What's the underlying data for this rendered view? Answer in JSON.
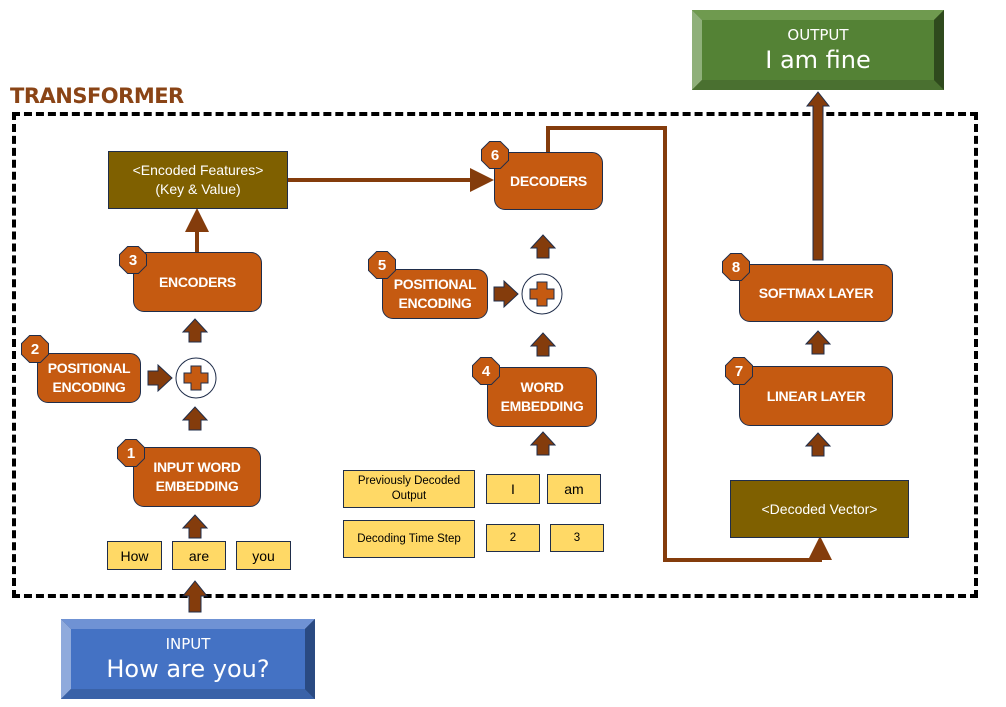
{
  "title": "TRANSFORMER",
  "output": {
    "label": "OUTPUT",
    "value": "I am fine"
  },
  "input": {
    "label": "INPUT",
    "value": "How are you?"
  },
  "encoded_features": {
    "line1": "<Encoded Features>",
    "line2": "(Key & Value)"
  },
  "decoded_vector": "<Decoded Vector>",
  "steps": [
    {
      "number": "1",
      "label_line1": "INPUT WORD",
      "label_line2": "EMBEDDING"
    },
    {
      "number": "2",
      "label_line1": "POSITIONAL",
      "label_line2": "ENCODING"
    },
    {
      "number": "3",
      "label_line1": "ENCODERS",
      "label_line2": ""
    },
    {
      "number": "4",
      "label_line1": "WORD",
      "label_line2": "EMBEDDING"
    },
    {
      "number": "5",
      "label_line1": "POSITIONAL",
      "label_line2": "ENCODING"
    },
    {
      "number": "6",
      "label_line1": "DECODERS",
      "label_line2": ""
    },
    {
      "number": "7",
      "label_line1": "LINEAR LAYER",
      "label_line2": ""
    },
    {
      "number": "8",
      "label_line1": "SOFTMAX LAYER",
      "label_line2": ""
    }
  ],
  "input_tokens": [
    "How",
    "are",
    "you"
  ],
  "decoder_inputs": {
    "prev_output_label_line1": "Previously Decoded",
    "prev_output_label_line2": "Output",
    "prev_output_tokens": [
      "I",
      "am"
    ],
    "time_step_label": "Decoding Time Step",
    "time_steps": [
      "2",
      "3"
    ]
  },
  "plus_symbol": "+",
  "colors": {
    "step_box": "#c55a11",
    "feature_box": "#7f6000",
    "token_box": "#ffd966",
    "arrow": "#843c0c",
    "output_box": "#548235",
    "input_box": "#4472c4",
    "title": "#8a4416"
  }
}
